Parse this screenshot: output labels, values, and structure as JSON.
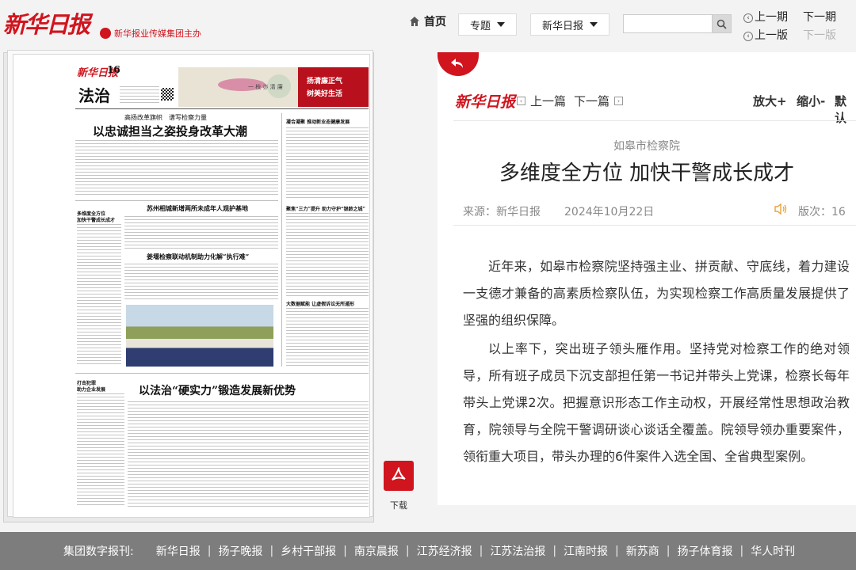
{
  "brand": {
    "logo": "新华日报",
    "sub": "新华报业传媒集团主办"
  },
  "topnav": {
    "home": "首页",
    "topic": "专题",
    "paper": "新华日报",
    "search_placeholder": "",
    "prev_issue": "上一期",
    "next_issue": "下一期",
    "prev_page": "上一版",
    "next_page": "下一版"
  },
  "page": {
    "masthead": "新华日报",
    "page_no": "16",
    "section": "法治",
    "banner_left": "一 枝 亦 清 廉",
    "banner_right_1": "扬清廉正气",
    "banner_right_2": "树美好生活",
    "kicker1": "高扬改革旗帜　谱写检察力量",
    "head1": "以忠诚担当之姿投身改革大潮",
    "side1": "凝合凝聚 推动新业态健康发展",
    "side_head_a": "多维度全方位",
    "side_head_b": "加快干警成长成才",
    "head2": "苏州相城新增两所未成年人观护基地",
    "side2": "聚焦“三力”提升 助力守护“银龄之城”",
    "head3": "姜堰检察联动机制助力化解“执行难”",
    "side3": "大数据赋能 让虚假诉讼无所遁形",
    "head4": "以法治“硬实力”锻造发展新优势",
    "col_head_a": "打击犯罪",
    "col_head_b": "助力企业发展",
    "download": "下载"
  },
  "article": {
    "logo": "新华日报",
    "prev": "上一篇",
    "next": "下一篇",
    "zoom_in": "放大+",
    "zoom_out": "缩小-",
    "default": "默认",
    "org": "如皋市检察院",
    "title": "多维度全方位 加快干警成长成才",
    "source": "来源：新华日报",
    "date": "2024年10月22日",
    "edition": "版次：16",
    "paragraphs": [
      "近年来，如皋市检察院坚持强主业、拼贡献、守底线，着力建设一支德才兼备的高素质检察队伍，为实现检察工作高质量发展提供了坚强的组织保障。",
      "以上率下，突出班子领头雁作用。坚持党对检察工作的绝对领导，所有班子成员下沉支部担任第一书记并带头上党课，检察长每年带头上党课2次。把握意识形态工作主动权，开展经常性思想政治教育，院领导与全院干警调研谈心谈话全覆盖。院领导领办重要案件，领衔重大项目，带头办理的6件案件入选全国、全省典型案例。"
    ]
  },
  "footer": {
    "label": "集团数字报刊:",
    "links": [
      "新华日报",
      "扬子晚报",
      "乡村干部报",
      "南京晨报",
      "江苏经济报",
      "江苏法治报",
      "江南时报",
      "新苏商",
      "扬子体育报",
      "华人时刊"
    ]
  },
  "colors": {
    "brand_red": "#d0151e",
    "footer_bg": "#7d7d7d"
  }
}
